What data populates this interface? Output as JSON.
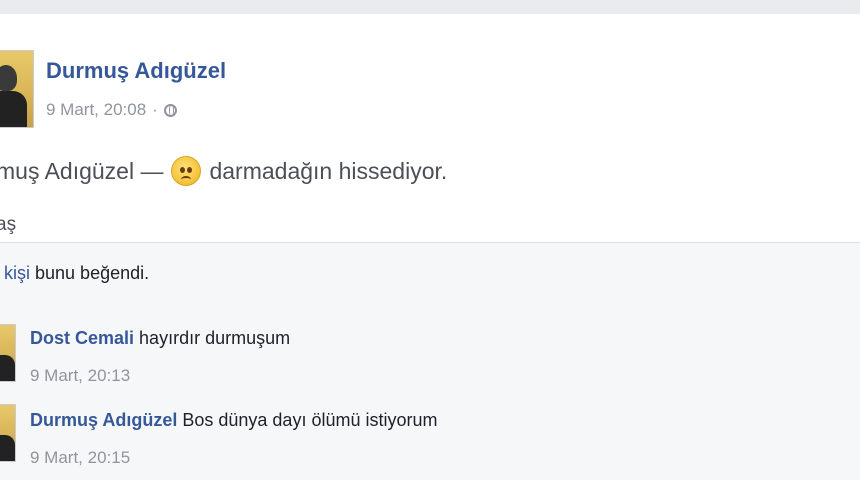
{
  "post": {
    "author": "Durmuş Adıgüzel",
    "date": "9 Mart, 20:08",
    "separator": "·",
    "privacy_icon": "globe-icon",
    "status_prefix": "muş Adıgüzel —",
    "feeling_icon": "sad-face-emoji",
    "status_feeling": "darmadağın hissediyor.",
    "share_label": "aş"
  },
  "likes": {
    "prefix": "kişi",
    "suffix": "bunu beğendi."
  },
  "comments": [
    {
      "name": "Dost Cemali",
      "text": "hayırdır durmuşum",
      "time": "9 Mart, 20:13"
    },
    {
      "name": "Durmuş Adıgüzel",
      "text": "Bos dünya dayı ölümü istiyorum",
      "time": "9 Mart, 20:15"
    }
  ],
  "colors": {
    "link": "#365899",
    "meta": "#90949c",
    "text": "#1d2129",
    "bg": "#e9ebee"
  }
}
